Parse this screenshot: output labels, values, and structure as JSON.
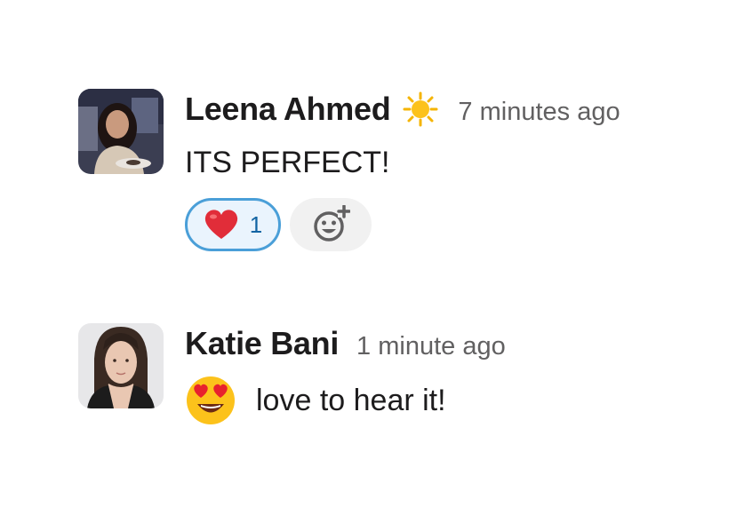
{
  "messages": [
    {
      "author": "Leena Ahmed",
      "status_icon": "sun-icon",
      "time": "7 minutes ago",
      "text": "ITS PERFECT!",
      "reactions": [
        {
          "emoji": "heart-icon",
          "count": "1",
          "selected": true
        }
      ],
      "add_reaction_icon": "add-reaction-icon"
    },
    {
      "author": "Katie Bani",
      "time": "1 minute ago",
      "emoji": "heart-eyes-emoji-icon",
      "text": "love to hear it!"
    }
  ],
  "colors": {
    "text": "#1d1c1d",
    "muted": "#616061",
    "reaction_border": "#4a9fd8",
    "reaction_bg": "#eaf4fd",
    "reaction_count": "#1264a3"
  }
}
